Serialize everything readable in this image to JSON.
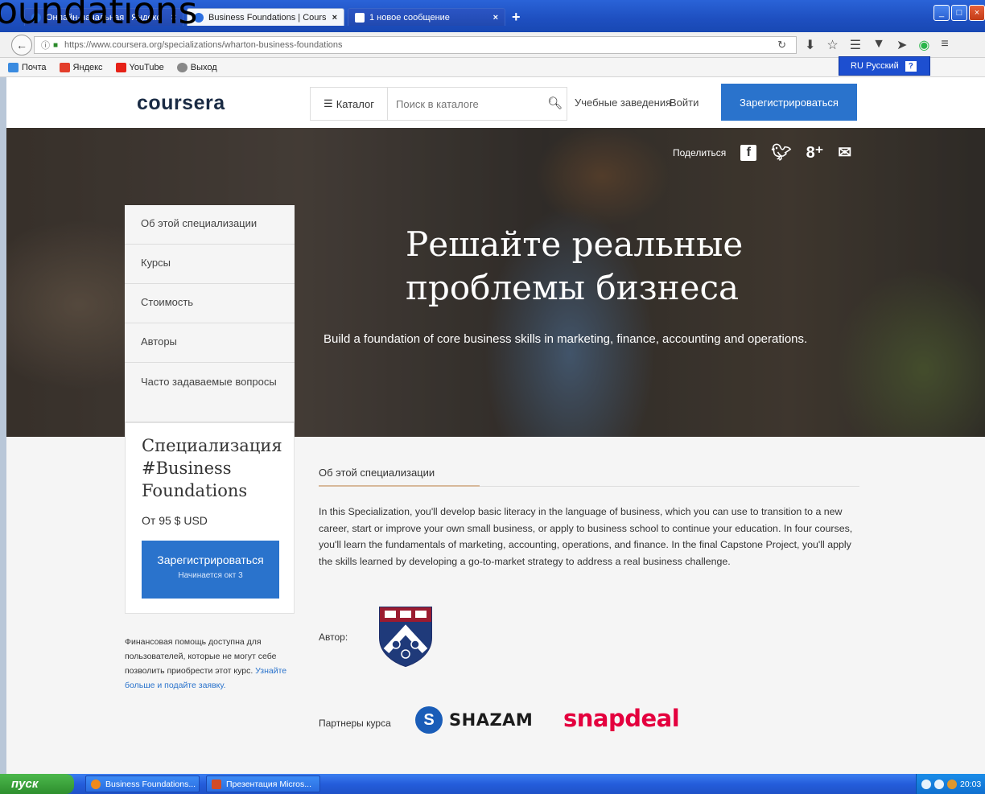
{
  "overlay_title": "oundations",
  "browser": {
    "tabs": [
      {
        "label": "Онлайн-начальная | Яндекс",
        "style": "dark"
      },
      {
        "label": "Business Foundations | Cours...",
        "style": "active"
      },
      {
        "label": "1 новое сообщение",
        "style": "dark"
      }
    ],
    "new_tab": "+",
    "url": "https://www.coursera.org/specializations/wharton-business-foundations",
    "bookmarks": [
      {
        "label": "Почта",
        "icon": "mail-icon",
        "color": "#3a8be0"
      },
      {
        "label": "Яндекс",
        "icon": "yandex-icon",
        "color": "#e33e2b"
      },
      {
        "label": "YouTube",
        "icon": "youtube-icon",
        "color": "#e62117"
      },
      {
        "label": "Выход",
        "icon": "globe-icon",
        "color": "#888888"
      }
    ],
    "language_bar": "RU Русский",
    "language_help": "?"
  },
  "header": {
    "logo": "coursera",
    "catalog_label": "Каталог",
    "search_placeholder": "Поиск в каталоге",
    "institutions": "Учебные заведения",
    "login": "Войти",
    "signup": "Зарегистрироваться"
  },
  "hero": {
    "share_label": "Поделиться",
    "title": "Решайте реальные проблемы бизнеса",
    "subtitle": "Build a foundation of core business skills in marketing, finance, accounting and operations."
  },
  "sidebar": {
    "items": [
      {
        "label": "Об этой специализации"
      },
      {
        "label": "Курсы"
      },
      {
        "label": "Стоимость"
      },
      {
        "label": "Авторы"
      },
      {
        "label": "Часто задаваемые вопросы"
      }
    ],
    "card": {
      "title": "Специализация #Business Foundations",
      "price": "От 95 $ USD",
      "button_label": "Зарегистрироваться",
      "button_sub": "Начинается окт 3"
    },
    "financial_aid": "Финансовая помощь доступна для пользователей, которые не могут себе позволить приобрести этот курс.",
    "financial_aid_link": "Узнайте больше и подайте заявку."
  },
  "main": {
    "about_heading": "Об этой специализации",
    "about_text": "In this Specialization, you'll develop basic literacy in the language of business, which you can use to transition to a new career, start or improve your own small business, or apply to business school to continue your education. In four courses, you'll learn the fundamentals of marketing, accounting, operations, and finance. In the final Capstone Project, you'll apply the skills learned by developing a go-to-market strategy to address a real business challenge.",
    "author_label": "Автор:",
    "partners_label": "Партнеры курса",
    "partner_1": "SHAZAM",
    "partner_2": "snapdeal"
  },
  "taskbar": {
    "start": "пуск",
    "tasks": [
      {
        "label": "Business Foundations..."
      },
      {
        "label": "Презентация Micros..."
      }
    ],
    "clock": "20:03"
  },
  "colors": {
    "accent_blue": "#2a73cc",
    "logo_dark": "#1a2b44",
    "snapdeal_red": "#e4003e"
  }
}
